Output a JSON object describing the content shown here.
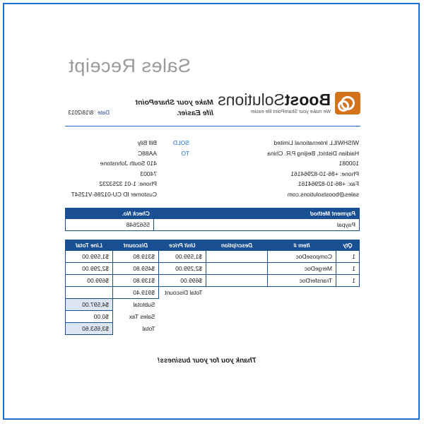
{
  "receipt": {
    "title": "Sales Receipt",
    "logo": {
      "brand_bold": "Boost",
      "brand_rest": "Solutions",
      "tagline": "We make your SharePoint life easier"
    },
    "slogan": [
      "Make your SharePoint",
      "life Easier."
    ],
    "date_label": "Date",
    "date_value": "8/18/2013",
    "company": [
      "WISHWILL International Limited",
      "Haidian District, Beijing P.R. China",
      "100081",
      "Phone: +86-10-82964161",
      "Fax: +86-10-82964161",
      "sales@boostsolutions.com"
    ],
    "sold_to_label": [
      "SOLD",
      "TO"
    ],
    "customer": [
      "Bill Bily",
      "AA88C",
      "410 South Johnstone",
      "74003",
      "Phone: 1-01 3253232",
      "Customer ID CU-01286-V1254T"
    ],
    "payment": {
      "headers": [
        "Payment Method",
        "Check No."
      ],
      "row": [
        "Paypal",
        "5562648"
      ]
    },
    "items": {
      "headers": [
        "Qty",
        "Item #",
        "Description",
        "Unit Price",
        "Discount",
        "Line Total"
      ],
      "rows": [
        [
          "1",
          "ComposeDoc",
          "",
          "$1,599.00",
          "$319.80",
          "$1,599.00"
        ],
        [
          "1",
          "MergeDoc",
          "",
          "$2,299.00",
          "$459.80",
          "$2,299.00"
        ],
        [
          "1",
          "TransferDoc",
          "",
          "$699.00",
          "$139.80",
          "$699.00"
        ]
      ]
    },
    "totals": {
      "total_discount_label": "Total Discount",
      "total_discount_value": "$919.40",
      "subtotal_label": "Subtotal",
      "subtotal_value": "$4,597.00",
      "sales_tax_label": "Sales Tax",
      "sales_tax_value": "$0.00",
      "total_label": "Total",
      "total_value": "$3,653.60"
    },
    "thanks": "Thank you for your business!"
  }
}
